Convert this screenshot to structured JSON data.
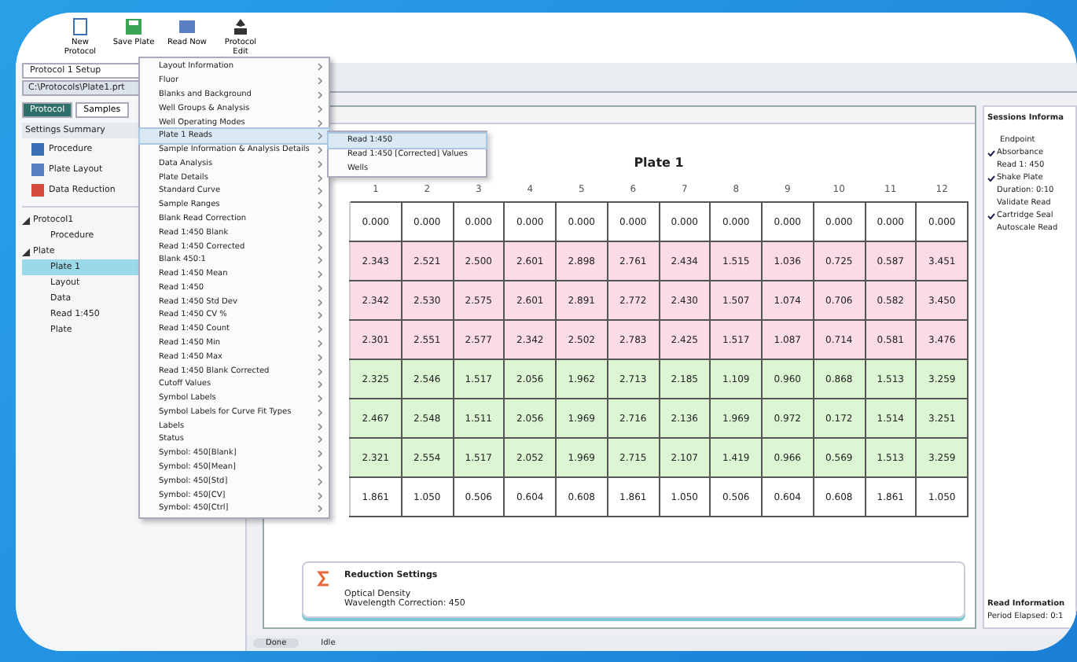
{
  "toolbar": [
    {
      "label": "New Protocol",
      "kind": "new"
    },
    {
      "label": "Save Plate",
      "kind": "save"
    },
    {
      "label": "Read Now",
      "kind": "read"
    },
    {
      "label": "Protocol Edit",
      "kind": "edit"
    }
  ],
  "left_panel": {
    "dropdown": "Protocol 1 Setup",
    "path": "C:\\Protocols\\Plate1.prt",
    "tabs": [
      {
        "label": "Protocol",
        "selected": true
      },
      {
        "label": "Samples",
        "selected": false
      }
    ],
    "section": "Settings Summary",
    "items": [
      {
        "label": "Procedure",
        "kind": "procedure"
      },
      {
        "label": "Plate Layout",
        "kind": "layout"
      },
      {
        "label": "Data Reduction",
        "kind": "reduction"
      }
    ],
    "tree": [
      {
        "label": "Protocol1",
        "expanded": true,
        "selected": false,
        "children": [
          {
            "label": "Procedure",
            "selected": false
          }
        ]
      },
      {
        "label": "Plate",
        "expanded": true,
        "selected": false,
        "children": [
          {
            "label": "Plate 1",
            "selected": true
          },
          {
            "label": "Layout",
            "selected": false
          },
          {
            "label": "Data",
            "selected": false
          },
          {
            "label": "Read 1:450",
            "selected": false
          },
          {
            "label": "Plate",
            "selected": false
          }
        ]
      }
    ]
  },
  "menu": {
    "items": [
      {
        "label": "Layout Information",
        "selected": false
      },
      {
        "label": "Fluor",
        "selected": false
      },
      {
        "label": "Blanks and Background",
        "selected": false
      },
      {
        "label": "Well Groups & Analysis",
        "selected": false
      },
      {
        "label": "Well Operating Modes",
        "selected": false
      },
      {
        "label": "Plate 1 Reads",
        "selected": true
      },
      {
        "label": "Sample Information & Analysis Details",
        "selected": false
      },
      {
        "label": "Data Analysis",
        "selected": false
      },
      {
        "label": "Plate Details",
        "selected": false
      },
      {
        "label": "Standard Curve",
        "selected": false
      },
      {
        "label": "Sample Ranges",
        "selected": false
      },
      {
        "label": "Blank Read Correction",
        "selected": false
      },
      {
        "label": "Read 1:450 Blank",
        "selected": false
      },
      {
        "label": "Read 1:450 Corrected",
        "selected": false
      },
      {
        "label": "Blank 450:1",
        "selected": false
      },
      {
        "label": "Read 1:450 Mean",
        "selected": false
      },
      {
        "label": "Read 1:450",
        "selected": false
      },
      {
        "label": "Read 1:450 Std Dev",
        "selected": false
      },
      {
        "label": "Read 1:450 CV %",
        "selected": false
      },
      {
        "label": "Read 1:450 Count",
        "selected": false
      },
      {
        "label": "Read 1:450 Min",
        "selected": false
      },
      {
        "label": "Read 1:450 Max",
        "selected": false
      },
      {
        "label": "Read 1:450 Blank Corrected",
        "selected": false
      },
      {
        "label": "Cutoff Values",
        "selected": false
      },
      {
        "label": "Symbol Labels",
        "selected": false
      },
      {
        "label": "Symbol Labels for Curve Fit Types",
        "selected": false
      },
      {
        "label": "Labels",
        "selected": false
      },
      {
        "label": "Status",
        "selected": false
      },
      {
        "label": "Symbol: 450[Blank]",
        "selected": false
      },
      {
        "label": "Symbol: 450[Mean]",
        "selected": false
      },
      {
        "label": "Symbol: 450[Std]",
        "selected": false
      },
      {
        "label": "Symbol: 450[CV]",
        "selected": false
      },
      {
        "label": "Symbol: 450[Ctrl]",
        "selected": false
      }
    ],
    "submenu": [
      {
        "label": "Read 1:450",
        "selected": true
      },
      {
        "label": "Read 1:450 [Corrected] Values",
        "selected": false
      },
      {
        "label": "Wells",
        "selected": false
      }
    ]
  },
  "document": {
    "title": "Plate 1",
    "columns": [
      "1",
      "2",
      "3",
      "4",
      "5",
      "6",
      "7",
      "8",
      "9",
      "10",
      "11",
      "12"
    ],
    "rows": [
      {
        "kind": "blank",
        "cells": [
          "0.000",
          "0.000",
          "0.000",
          "0.000",
          "0.000",
          "0.000",
          "0.000",
          "0.000",
          "0.000",
          "0.000",
          "0.000",
          "0.000"
        ]
      },
      {
        "kind": "sample",
        "cells": [
          "2.343",
          "2.521",
          "2.500",
          "2.601",
          "2.898",
          "2.761",
          "2.434",
          "1.515",
          "1.036",
          "0.725",
          "0.587",
          "3.451"
        ]
      },
      {
        "kind": "sample",
        "cells": [
          "2.342",
          "2.530",
          "2.575",
          "2.601",
          "2.891",
          "2.772",
          "2.430",
          "1.507",
          "1.074",
          "0.706",
          "0.582",
          "3.450"
        ]
      },
      {
        "kind": "sample",
        "cells": [
          "2.301",
          "2.551",
          "2.577",
          "2.342",
          "2.502",
          "2.783",
          "2.425",
          "1.517",
          "1.087",
          "0.714",
          "0.581",
          "3.476"
        ]
      },
      {
        "kind": "control",
        "cells": [
          "2.325",
          "2.546",
          "1.517",
          "2.056",
          "1.962",
          "2.713",
          "2.185",
          "1.109",
          "0.960",
          "0.868",
          "1.513",
          "3.259"
        ]
      },
      {
        "kind": "control",
        "cells": [
          "2.467",
          "2.548",
          "1.511",
          "2.056",
          "1.969",
          "2.716",
          "2.136",
          "1.969",
          "0.972",
          "0.172",
          "1.514",
          "3.251"
        ]
      },
      {
        "kind": "control",
        "cells": [
          "2.321",
          "2.554",
          "1.517",
          "2.052",
          "1.969",
          "2.715",
          "2.107",
          "1.419",
          "0.966",
          "0.569",
          "1.513",
          "3.259"
        ]
      },
      {
        "kind": "blank",
        "cells": [
          "1.861",
          "1.050",
          "0.506",
          "0.604",
          "0.608",
          "1.861",
          "1.050",
          "0.506",
          "0.604",
          "0.608",
          "1.861",
          "1.050"
        ]
      }
    ],
    "reduction": {
      "title": "Reduction Settings",
      "lines": [
        "Optical Density",
        "Wavelength Correction: 450"
      ]
    }
  },
  "side_panel": {
    "title": "Sessions Informa",
    "heading": "Endpoint",
    "lines": [
      {
        "text": "Absorbance",
        "checked": true
      },
      {
        "text": "Read 1: 450",
        "checked": false
      },
      {
        "text": "Shake Plate",
        "checked": true
      },
      {
        "text": "Duration: 0:10",
        "checked": false
      },
      {
        "text": "Validate Read",
        "checked": false
      },
      {
        "text": "Cartridge Seal",
        "checked": true
      },
      {
        "text": "Autoscale Read",
        "checked": false
      }
    ],
    "footer_title": "Read Information",
    "footer_text": "Period Elapsed: 0:1"
  },
  "status_bar": {
    "field": "Done",
    "text": "Idle"
  }
}
